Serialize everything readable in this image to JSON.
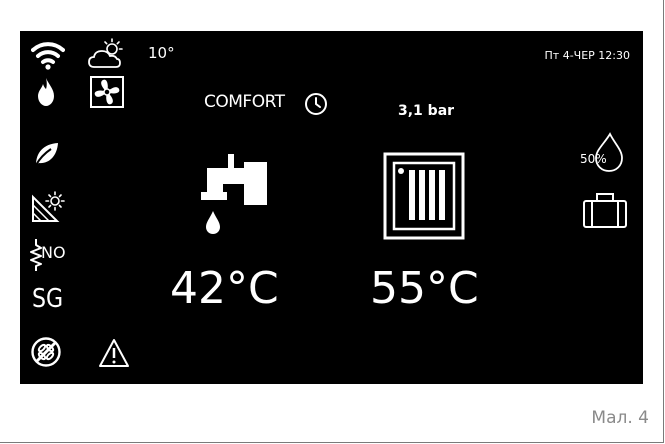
{
  "status": {
    "outside_temp": "10°",
    "datetime": "Пт 4-ЧЕР 12:30"
  },
  "mode": {
    "label": "COMFORT",
    "pressure": "3,1 bar"
  },
  "humidity": "50%",
  "sidebar": {
    "no_label": "NO",
    "sg_label": "SG"
  },
  "dhw": {
    "temperature": "42°C"
  },
  "heating": {
    "temperature": "55°C"
  },
  "caption": "Мал. 4",
  "colors": {
    "screen": "#000000",
    "foreground": "#ffffff",
    "caption": "#8a8a8a"
  }
}
